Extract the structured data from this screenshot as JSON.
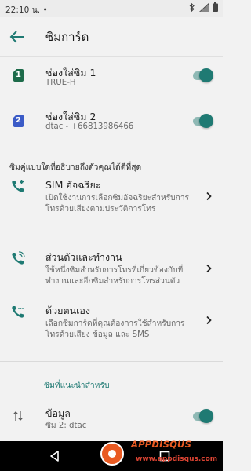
{
  "status_bar": {
    "time": "22:10 น.",
    "dot": "•"
  },
  "app_bar": {
    "title": "ซิมการ์ด",
    "back_icon": "arrow-back-icon"
  },
  "sims": [
    {
      "badge": "1",
      "title": "ช่องใส่ซิม 1",
      "subtitle": "TRUE-H",
      "enabled": true,
      "color": "#1d6b4a"
    },
    {
      "badge": "2",
      "title": "ช่องใส่ซิม 2",
      "subtitle": "dtac - +66813986466",
      "enabled": true,
      "color": "#3b5bc7"
    }
  ],
  "preference_section": {
    "label": "ซิมคู่แบบใดที่อธิบายถึงตัวคุณได้ดีที่สุด"
  },
  "modes": [
    {
      "icon": "smart-sim-phone-icon",
      "title": "SIM อัจฉริยะ",
      "line1": "เปิดใช้งานการเลือกซิมอัจฉริยะสำหรับการ",
      "line2": "โทรด้วยเสียงตามประวัติการโทร"
    },
    {
      "icon": "personal-work-phone-icon",
      "title": "ส่วนตัวและทำงาน",
      "line1": "ใช้หนึ่งซิมสำหรับการโทรที่เกี่ยวข้องกับที่",
      "line2": "ทำงานและอีกซิมสำหรับการโทรส่วนตัว"
    },
    {
      "icon": "manual-phone-icon",
      "title": "ด้วยตนเอง",
      "line1": "เลือกซิมการ์ดที่คุณต้องการใช้สำหรับการ",
      "line2": "โทรด้วยเสียง ข้อมูล และ SMS"
    }
  ],
  "suggested_section": {
    "label": "ซิมที่แนะนำสำหรับ"
  },
  "data_row": {
    "icon": "data-arrows-icon",
    "title": "ข้อมูล",
    "subtitle": "ซิม 2: dtac",
    "enabled": true
  },
  "colors": {
    "accent": "#1f7a73",
    "background": "#f2f2f2"
  },
  "watermark": {
    "text": "APPDISQUS",
    "url": "www.appdisqus.com"
  }
}
